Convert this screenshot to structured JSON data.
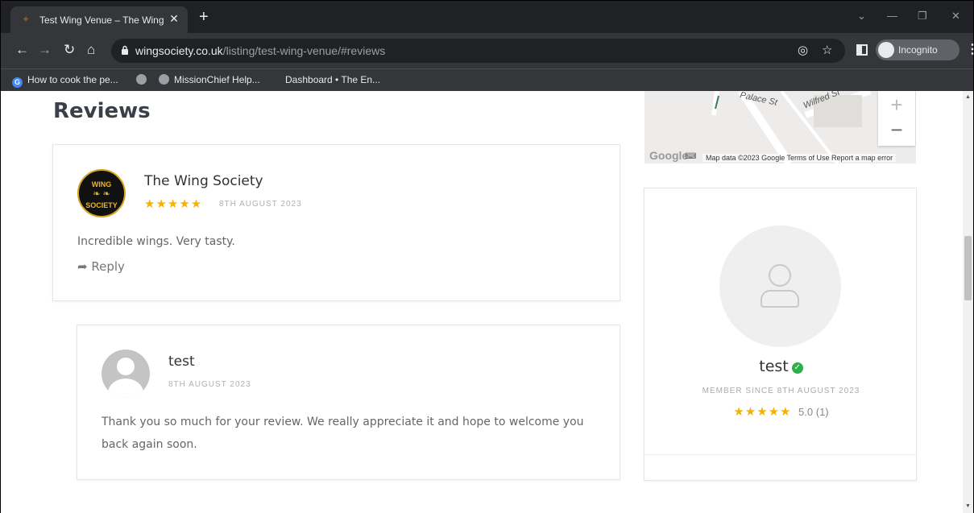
{
  "browser": {
    "tab_title": "Test Wing Venue – The Wing Soc",
    "tab_close": "✕",
    "new_tab": "+",
    "url_domain": "wingsociety.co.uk",
    "url_path": "/listing/test-wing-venue/#reviews",
    "incognito_label": "Incognito",
    "bookmarks": [
      "How to cook the pe...",
      "",
      "MissionChief Help...",
      "Dashboard • The En..."
    ]
  },
  "page": {
    "section_title": "Reviews",
    "review": {
      "author": "The Wing Society",
      "stars": "★★★★★",
      "date": "8TH AUGUST 2023",
      "text": "Incredible wings. Very tasty.",
      "reply_label": "Reply",
      "logo_top": "WING",
      "logo_bottom": "SOCIETY"
    },
    "reply": {
      "author": "test",
      "date": "8TH AUGUST 2023",
      "text_line1": "Thank you so much for your review. We really appreciate it and hope to welcome you",
      "text_line2": "back again soon."
    },
    "map": {
      "road1": "Palace St",
      "road2": "Wilfred St",
      "attribution": "Map data ©2023 Google   Terms of Use   Report a map error",
      "logo": "Google"
    },
    "profile": {
      "name": "test",
      "member_since": "MEMBER SINCE 8TH AUGUST 2023",
      "stars": "★★★★★",
      "rating": "5.0",
      "rating_count": "(1)"
    }
  },
  "colors": {
    "star": "#f5b301",
    "verified": "#2db04a",
    "chrome_dark": "#202124"
  }
}
